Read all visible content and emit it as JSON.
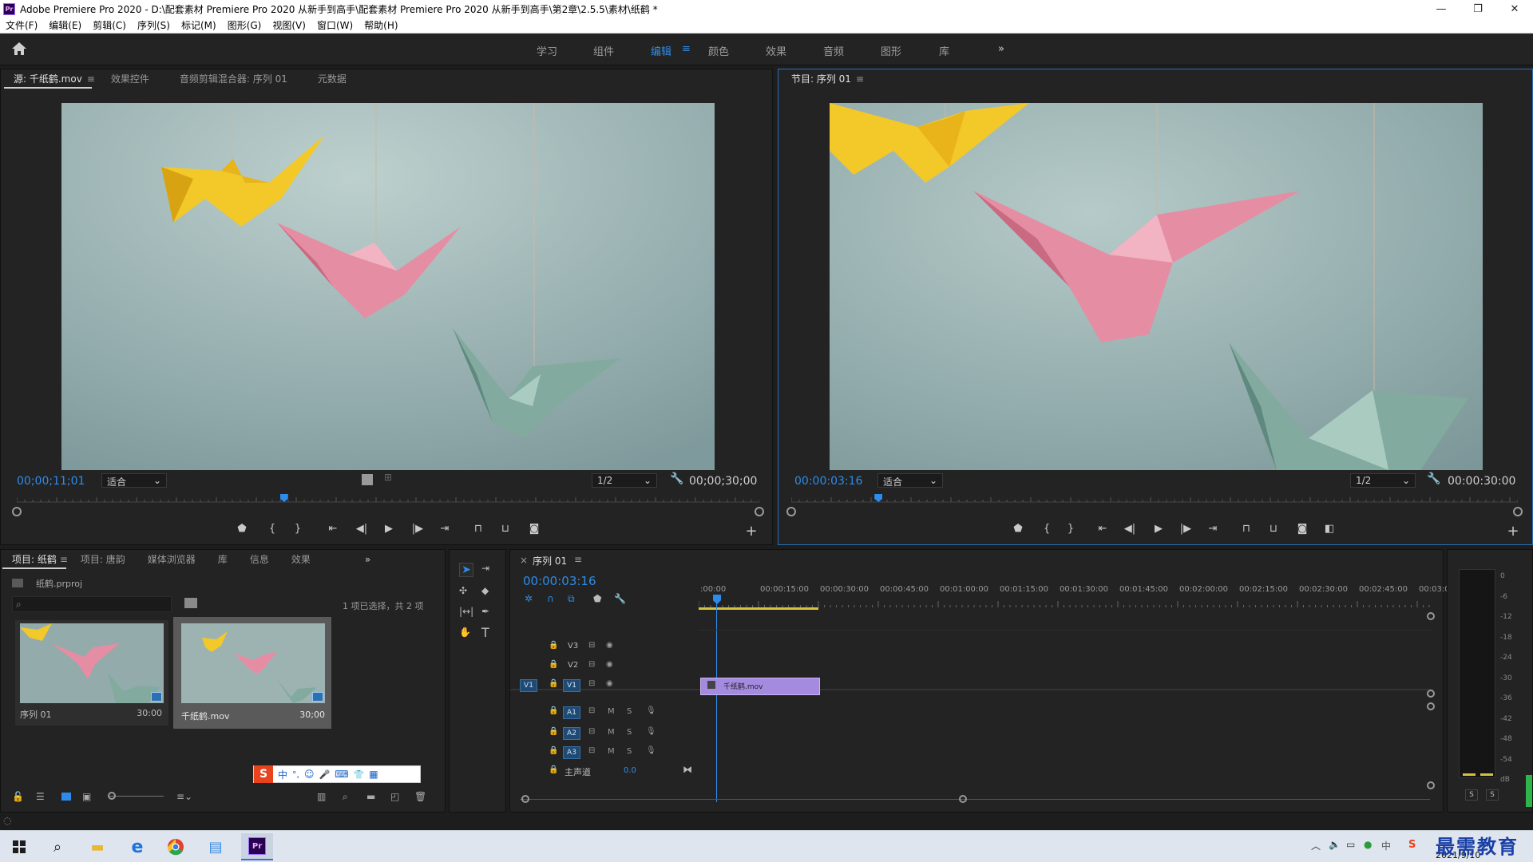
{
  "window": {
    "title": "Adobe Premiere Pro 2020 - D:\\配套素材 Premiere Pro 2020 从新手到高手\\配套素材 Premiere Pro 2020 从新手到高手\\第2章\\2.5.5\\素材\\纸鹤 *",
    "app_badge": "Pr",
    "minimize": "—",
    "maximize": "❐",
    "close": "✕"
  },
  "menu": [
    "文件(F)",
    "编辑(E)",
    "剪辑(C)",
    "序列(S)",
    "标记(M)",
    "图形(G)",
    "视图(V)",
    "窗口(W)",
    "帮助(H)"
  ],
  "workspaces": {
    "items": [
      "学习",
      "组件",
      "编辑",
      "颜色",
      "效果",
      "音频",
      "图形",
      "库"
    ],
    "active": "编辑",
    "more": "»"
  },
  "source_panel": {
    "tabs": [
      "源: 千纸鹤.mov",
      "效果控件",
      "音频剪辑混合器: 序列 01",
      "元数据"
    ],
    "menu_icon": "≡",
    "timecode": "00;00;11;01",
    "fit": "适合",
    "resolution": "1/2",
    "duration": "00;00;30;00",
    "playhead_fraction": 0.36
  },
  "program_panel": {
    "tab": "节目: 序列 01",
    "menu_icon": "≡",
    "timecode": "00:00:03:16",
    "fit": "适合",
    "resolution": "1/2",
    "duration": "00:00:30:00",
    "playhead_fraction": 0.12
  },
  "project_panel": {
    "tabs": [
      "项目: 纸鹤",
      "项目: 唐韵",
      "媒体浏览器",
      "库",
      "信息",
      "效果"
    ],
    "project_file": "纸鹤.prproj",
    "selection_info": "1 项已选择，共 2 项",
    "items": [
      {
        "name": "序列 01",
        "duration": "30:00"
      },
      {
        "name": "千纸鹤.mov",
        "duration": "30;00"
      }
    ]
  },
  "timeline": {
    "tab": "序列 01",
    "close": "×",
    "timecode": "00:00:03:16",
    "ruler_labels": [
      ":00:00",
      "00:00:15:00",
      "00:00:30:00",
      "00:00:45:00",
      "00:01:00:00",
      "00:01:15:00",
      "00:01:30:00",
      "00:01:45:00",
      "00:02:00:00",
      "00:02:15:00",
      "00:02:30:00",
      "00:02:45:00",
      "00:03:0("
    ],
    "video_tracks": [
      "V3",
      "V2",
      "V1"
    ],
    "audio_tracks": [
      "A1",
      "A2",
      "A3"
    ],
    "source_patch_v": "V1",
    "mute": "M",
    "solo": "S",
    "master_label": "主声道",
    "master_value": "0.0",
    "clip_name": "千纸鹤.mov"
  },
  "audio_meter": {
    "scale": [
      "0",
      "-6",
      "-12",
      "-18",
      "-24",
      "-30",
      "-36",
      "-42",
      "-48",
      "-54",
      "dB"
    ],
    "solo_buttons": [
      "S",
      "S"
    ]
  },
  "ime_bar": [
    "中",
    "°,",
    "☺",
    "🎤",
    "⌨",
    "👕",
    "▦"
  ],
  "taskbar": {
    "date": "2021/9/10",
    "watermark": "最需教育",
    "apps": [
      "windows-start",
      "search",
      "file-explorer",
      "edge",
      "chrome",
      "photos",
      "premiere"
    ]
  },
  "colors": {
    "accent_blue": "#2d8ceb",
    "clip_purple": "#a48be0",
    "workarea_yellow": "#d6c23a",
    "panel_bg": "#232323"
  }
}
